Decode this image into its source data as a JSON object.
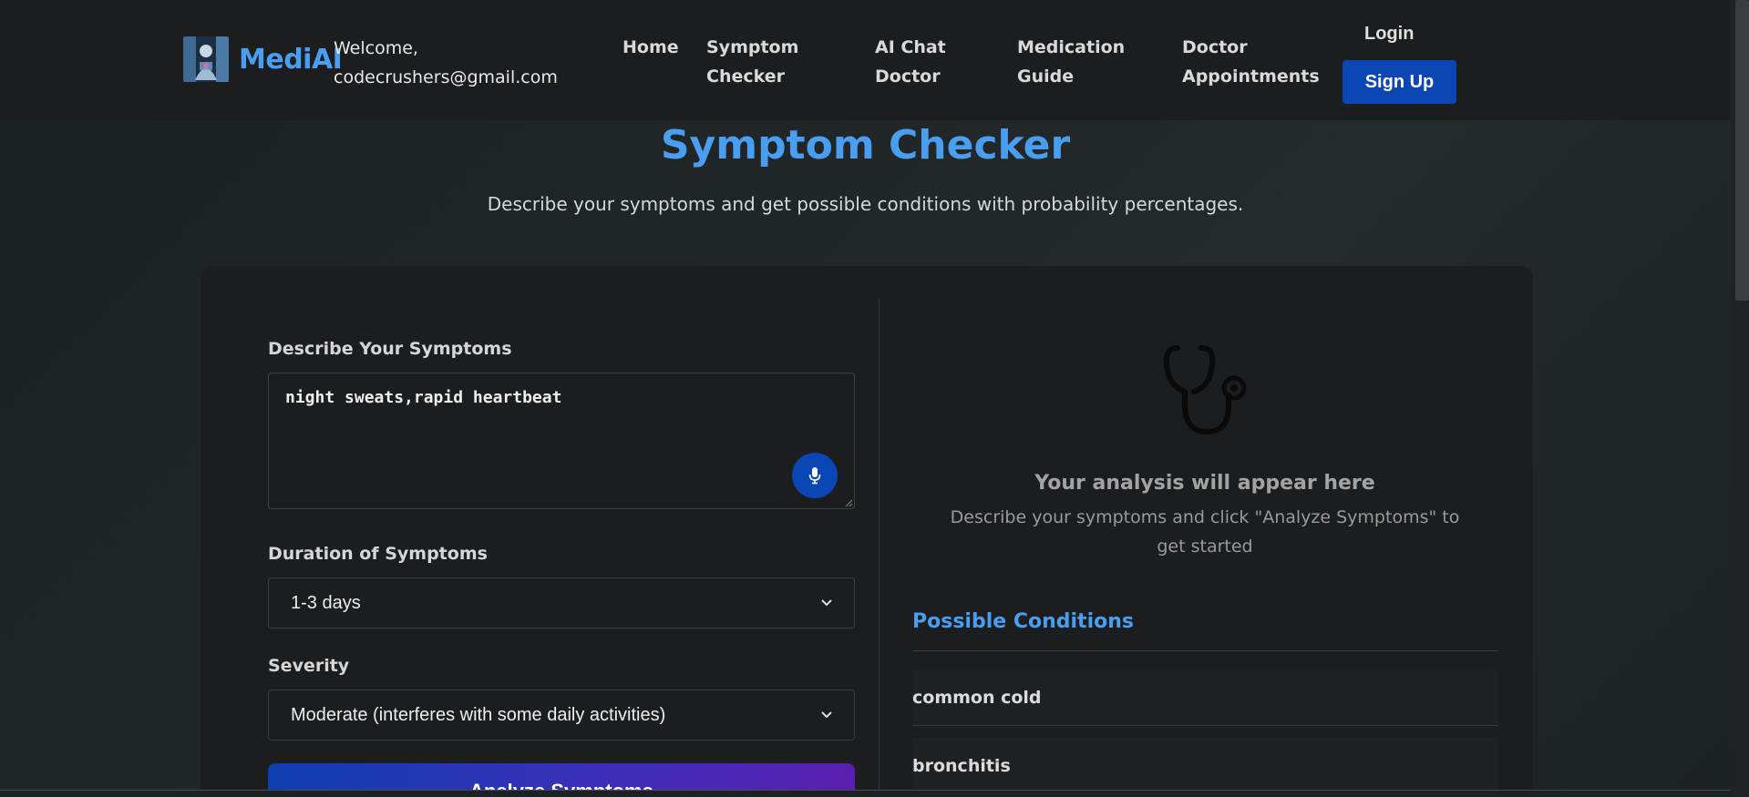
{
  "header": {
    "brand": "MediAI",
    "welcome_line1": "Welcome,",
    "welcome_line2": "codecrushers@gmail.com",
    "nav": [
      {
        "line1": "Home",
        "line2": ""
      },
      {
        "line1": "Symptom",
        "line2": "Checker"
      },
      {
        "line1": "AI Chat",
        "line2": "Doctor"
      },
      {
        "line1": "Medication",
        "line2": "Guide"
      },
      {
        "line1": "Doctor",
        "line2": "Appointments"
      }
    ],
    "login_label": "Login",
    "signup_label": "Sign Up"
  },
  "page": {
    "title": "Symptom Checker",
    "subtitle": "Describe your symptoms and get possible conditions with probability percentages."
  },
  "form": {
    "symptoms_label": "Describe Your Symptoms",
    "symptoms_value": "night sweats,rapid heartbeat",
    "duration_label": "Duration of Symptoms",
    "duration_value": "1-3 days",
    "severity_label": "Severity",
    "severity_value": "Moderate (interferes with some daily activities)",
    "analyze_label": "Analyze Symptoms"
  },
  "results": {
    "placeholder_title": "Your analysis will appear here",
    "placeholder_desc": "Describe your symptoms and click \"Analyze Symptoms\" to get started",
    "conditions_heading": "Possible Conditions",
    "conditions": [
      {
        "name": "common cold"
      },
      {
        "name": "bronchitis"
      }
    ]
  },
  "colors": {
    "accent": "#4a9ef0",
    "primary_button": "#0b46b5",
    "header_bg": "#1c1d1f",
    "card_bg": "#1c1d1f"
  },
  "icons": {
    "microphone": "microphone-icon",
    "stethoscope": "stethoscope-icon",
    "chevron": "chevron-down-icon"
  }
}
